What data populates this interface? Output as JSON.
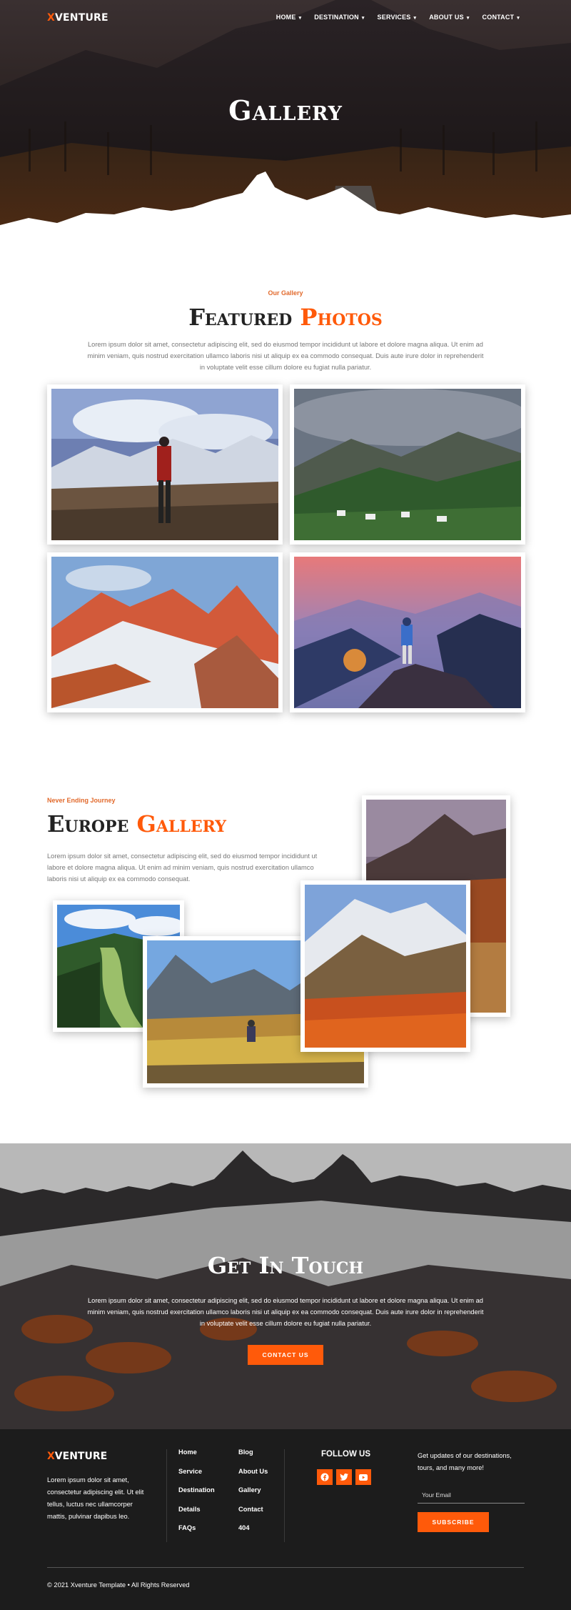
{
  "brand": {
    "x": "X",
    "rest": "VENTURE"
  },
  "nav": {
    "items": [
      {
        "label": "HOME"
      },
      {
        "label": "DESTINATION"
      },
      {
        "label": "SERVICES"
      },
      {
        "label": "ABOUT US"
      },
      {
        "label": "CONTACT"
      }
    ]
  },
  "hero": {
    "title": "Gallery"
  },
  "featured": {
    "eyebrow": "Our Gallery",
    "title_main": "Featured",
    "title_accent": "Photos",
    "description": "Lorem ipsum dolor sit amet, consectetur adipiscing elit, sed do eiusmod tempor incididunt ut labore et dolore magna aliqua. Ut enim ad minim veniam, quis nostrud exercitation ullamco laboris nisi ut aliquip ex ea commodo consequat. Duis aute irure dolor in reprehenderit in voluptate velit esse cillum dolore eu fugiat nulla pariatur."
  },
  "europe": {
    "eyebrow": "Never Ending Journey",
    "title_main": "Europe",
    "title_accent": "Gallery",
    "description": "Lorem ipsum dolor sit amet, consectetur adipiscing elit, sed do eiusmod tempor incididunt ut labore et dolore magna aliqua. Ut enim ad minim veniam, quis nostrud exercitation ullamco laboris nisi ut aliquip ex ea commodo consequat."
  },
  "contact": {
    "title": "Get In Touch",
    "description": "Lorem ipsum dolor sit amet, consectetur adipiscing elit, sed do eiusmod tempor incididunt ut labore et dolore magna aliqua. Ut enim ad minim veniam, quis nostrud exercitation ullamco laboris nisi ut aliquip ex ea commodo consequat. Duis aute irure dolor in reprehenderit in voluptate velit esse cillum dolore eu fugiat nulla pariatur.",
    "button": "CONTACT US"
  },
  "footer": {
    "about": "Lorem ipsum dolor sit amet, consectetur adipiscing elit. Ut elit tellus, luctus nec ullamcorper mattis, pulvinar dapibus leo.",
    "col1": [
      "Home",
      "Service",
      "Destination",
      "Details",
      "FAQs"
    ],
    "col2": [
      "Blog",
      "About Us",
      "Gallery",
      "Contact",
      "404"
    ],
    "follow": "FOLLOW US",
    "social": [
      "facebook-icon",
      "twitter-icon",
      "youtube-icon"
    ],
    "newsletter_text": "Get updates of our destinations, tours, and many more!",
    "email_placeholder": "Your Email",
    "subscribe": "SUBSCRIBE",
    "copyright": "© 2021 Xventure Template • All Rights Reserved"
  },
  "colors": {
    "accent": "#ff5a0a",
    "eyebrow": "#e26a2c",
    "footer_bg": "#1c1c1c"
  }
}
